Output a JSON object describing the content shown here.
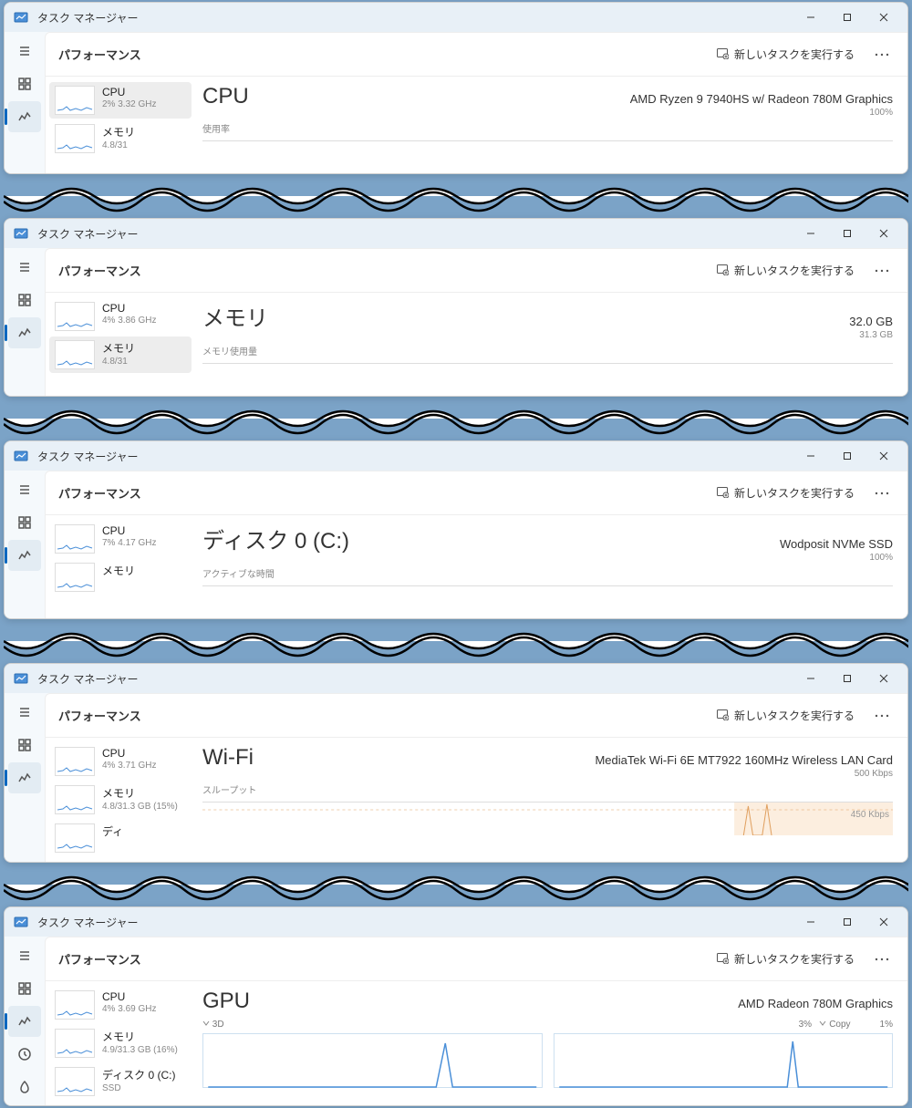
{
  "app_title": "タスク マネージャー",
  "page_header": "パフォーマンス",
  "new_task_label": "新しいタスクを実行する",
  "windows": [
    {
      "selected": "cpu",
      "sidebar": [
        {
          "id": "cpu",
          "name": "CPU",
          "sub": "2%  3.32 GHz"
        },
        {
          "id": "mem",
          "name": "メモリ",
          "sub": "4.8/31"
        }
      ],
      "detail": {
        "title": "CPU",
        "sub": "使用率",
        "right1": "AMD Ryzen 9 7940HS w/ Radeon 780M Graphics",
        "right2": "100%"
      }
    },
    {
      "selected": "mem",
      "sidebar": [
        {
          "id": "cpu",
          "name": "CPU",
          "sub": "4%  3.86 GHz"
        },
        {
          "id": "mem",
          "name": "メモリ",
          "sub": "4.8/31"
        }
      ],
      "detail": {
        "title": "メモリ",
        "sub": "メモリ使用量",
        "right1": "32.0 GB",
        "right2": "31.3 GB"
      }
    },
    {
      "selected": "disk",
      "sidebar": [
        {
          "id": "cpu",
          "name": "CPU",
          "sub": "7%  4.17 GHz"
        },
        {
          "id": "mem",
          "name": "メモリ",
          "sub": ""
        }
      ],
      "detail": {
        "title": "ディスク 0 (C:)",
        "sub": "アクティブな時間",
        "right1": "Wodposit NVMe SSD",
        "right2": "100%"
      }
    },
    {
      "selected": "wifi",
      "sidebar": [
        {
          "id": "cpu",
          "name": "CPU",
          "sub": "4%  3.71 GHz"
        },
        {
          "id": "mem",
          "name": "メモリ",
          "sub": "4.8/31.3 GB (15%)"
        },
        {
          "id": "disk",
          "name": "ディ",
          "sub": ""
        }
      ],
      "detail": {
        "title": "Wi-Fi",
        "sub": "スループット",
        "right1": "MediaTek Wi-Fi 6E MT7922 160MHz Wireless LAN Card",
        "right2": "500 Kbps",
        "axis": "450 Kbps"
      }
    },
    {
      "selected": "gpu",
      "sidebar": [
        {
          "id": "cpu",
          "name": "CPU",
          "sub": "4%  3.69 GHz"
        },
        {
          "id": "mem",
          "name": "メモリ",
          "sub": "4.9/31.3 GB (16%)"
        },
        {
          "id": "disk",
          "name": "ディスク 0 (C:)",
          "sub": "SSD"
        }
      ],
      "detail": {
        "title": "GPU",
        "sub": "",
        "right1": "AMD Radeon 780M Graphics",
        "right2": "",
        "subcharts": [
          {
            "label": "3D",
            "pct": "3%"
          },
          {
            "label": "Copy",
            "pct": "1%"
          }
        ]
      }
    }
  ]
}
